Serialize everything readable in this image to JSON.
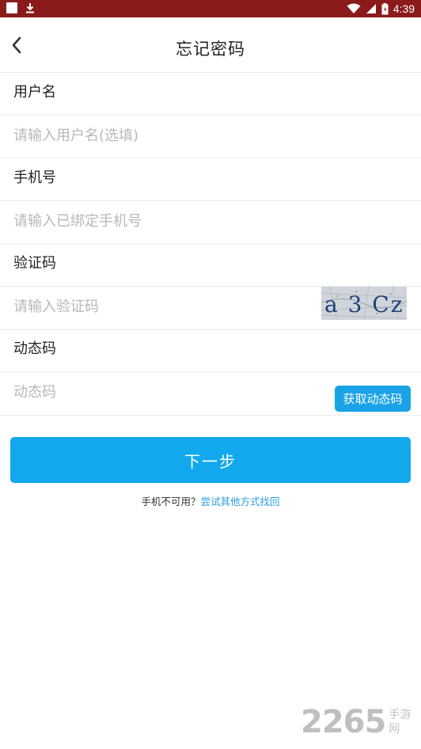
{
  "status_bar": {
    "time": "4:39",
    "icons": [
      "notification-square-icon",
      "download-icon",
      "wifi-icon",
      "signal-icon",
      "battery-icon"
    ]
  },
  "header": {
    "title": "忘记密码",
    "back_icon": "chevron-left-icon"
  },
  "form": {
    "username": {
      "label": "用户名",
      "placeholder": "请输入用户名(选填)",
      "value": ""
    },
    "phone": {
      "label": "手机号",
      "placeholder": "请输入已绑定手机号",
      "value": ""
    },
    "captcha": {
      "label": "验证码",
      "placeholder": "请输入验证码",
      "value": "",
      "image_text": "a 3 Cz"
    },
    "otp": {
      "label": "动态码",
      "placeholder": "动态码",
      "value": "",
      "button_label": "获取动态码"
    }
  },
  "next_button": "下一步",
  "help": {
    "prefix": "手机不可用？",
    "link": "尝试其他方式找回"
  },
  "watermark": {
    "number": "2265",
    "text": "手游网"
  },
  "colors": {
    "status_bar": "#8b1a1a",
    "primary": "#12a8ee",
    "link": "#2a9fe0"
  }
}
